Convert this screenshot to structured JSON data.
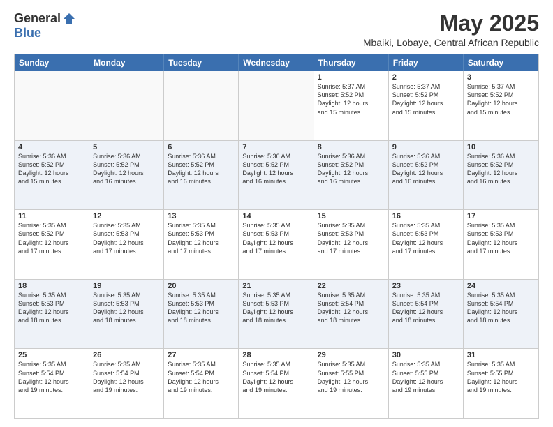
{
  "logo": {
    "general": "General",
    "blue": "Blue"
  },
  "title": "May 2025",
  "location": "Mbaiki, Lobaye, Central African Republic",
  "days_header": [
    "Sunday",
    "Monday",
    "Tuesday",
    "Wednesday",
    "Thursday",
    "Friday",
    "Saturday"
  ],
  "rows": [
    [
      {
        "day": "",
        "info": ""
      },
      {
        "day": "",
        "info": ""
      },
      {
        "day": "",
        "info": ""
      },
      {
        "day": "",
        "info": ""
      },
      {
        "day": "1",
        "info": "Sunrise: 5:37 AM\nSunset: 5:52 PM\nDaylight: 12 hours\nand 15 minutes."
      },
      {
        "day": "2",
        "info": "Sunrise: 5:37 AM\nSunset: 5:52 PM\nDaylight: 12 hours\nand 15 minutes."
      },
      {
        "day": "3",
        "info": "Sunrise: 5:37 AM\nSunset: 5:52 PM\nDaylight: 12 hours\nand 15 minutes."
      }
    ],
    [
      {
        "day": "4",
        "info": "Sunrise: 5:36 AM\nSunset: 5:52 PM\nDaylight: 12 hours\nand 15 minutes."
      },
      {
        "day": "5",
        "info": "Sunrise: 5:36 AM\nSunset: 5:52 PM\nDaylight: 12 hours\nand 16 minutes."
      },
      {
        "day": "6",
        "info": "Sunrise: 5:36 AM\nSunset: 5:52 PM\nDaylight: 12 hours\nand 16 minutes."
      },
      {
        "day": "7",
        "info": "Sunrise: 5:36 AM\nSunset: 5:52 PM\nDaylight: 12 hours\nand 16 minutes."
      },
      {
        "day": "8",
        "info": "Sunrise: 5:36 AM\nSunset: 5:52 PM\nDaylight: 12 hours\nand 16 minutes."
      },
      {
        "day": "9",
        "info": "Sunrise: 5:36 AM\nSunset: 5:52 PM\nDaylight: 12 hours\nand 16 minutes."
      },
      {
        "day": "10",
        "info": "Sunrise: 5:36 AM\nSunset: 5:52 PM\nDaylight: 12 hours\nand 16 minutes."
      }
    ],
    [
      {
        "day": "11",
        "info": "Sunrise: 5:35 AM\nSunset: 5:52 PM\nDaylight: 12 hours\nand 17 minutes."
      },
      {
        "day": "12",
        "info": "Sunrise: 5:35 AM\nSunset: 5:53 PM\nDaylight: 12 hours\nand 17 minutes."
      },
      {
        "day": "13",
        "info": "Sunrise: 5:35 AM\nSunset: 5:53 PM\nDaylight: 12 hours\nand 17 minutes."
      },
      {
        "day": "14",
        "info": "Sunrise: 5:35 AM\nSunset: 5:53 PM\nDaylight: 12 hours\nand 17 minutes."
      },
      {
        "day": "15",
        "info": "Sunrise: 5:35 AM\nSunset: 5:53 PM\nDaylight: 12 hours\nand 17 minutes."
      },
      {
        "day": "16",
        "info": "Sunrise: 5:35 AM\nSunset: 5:53 PM\nDaylight: 12 hours\nand 17 minutes."
      },
      {
        "day": "17",
        "info": "Sunrise: 5:35 AM\nSunset: 5:53 PM\nDaylight: 12 hours\nand 17 minutes."
      }
    ],
    [
      {
        "day": "18",
        "info": "Sunrise: 5:35 AM\nSunset: 5:53 PM\nDaylight: 12 hours\nand 18 minutes."
      },
      {
        "day": "19",
        "info": "Sunrise: 5:35 AM\nSunset: 5:53 PM\nDaylight: 12 hours\nand 18 minutes."
      },
      {
        "day": "20",
        "info": "Sunrise: 5:35 AM\nSunset: 5:53 PM\nDaylight: 12 hours\nand 18 minutes."
      },
      {
        "day": "21",
        "info": "Sunrise: 5:35 AM\nSunset: 5:53 PM\nDaylight: 12 hours\nand 18 minutes."
      },
      {
        "day": "22",
        "info": "Sunrise: 5:35 AM\nSunset: 5:54 PM\nDaylight: 12 hours\nand 18 minutes."
      },
      {
        "day": "23",
        "info": "Sunrise: 5:35 AM\nSunset: 5:54 PM\nDaylight: 12 hours\nand 18 minutes."
      },
      {
        "day": "24",
        "info": "Sunrise: 5:35 AM\nSunset: 5:54 PM\nDaylight: 12 hours\nand 18 minutes."
      }
    ],
    [
      {
        "day": "25",
        "info": "Sunrise: 5:35 AM\nSunset: 5:54 PM\nDaylight: 12 hours\nand 19 minutes."
      },
      {
        "day": "26",
        "info": "Sunrise: 5:35 AM\nSunset: 5:54 PM\nDaylight: 12 hours\nand 19 minutes."
      },
      {
        "day": "27",
        "info": "Sunrise: 5:35 AM\nSunset: 5:54 PM\nDaylight: 12 hours\nand 19 minutes."
      },
      {
        "day": "28",
        "info": "Sunrise: 5:35 AM\nSunset: 5:54 PM\nDaylight: 12 hours\nand 19 minutes."
      },
      {
        "day": "29",
        "info": "Sunrise: 5:35 AM\nSunset: 5:55 PM\nDaylight: 12 hours\nand 19 minutes."
      },
      {
        "day": "30",
        "info": "Sunrise: 5:35 AM\nSunset: 5:55 PM\nDaylight: 12 hours\nand 19 minutes."
      },
      {
        "day": "31",
        "info": "Sunrise: 5:35 AM\nSunset: 5:55 PM\nDaylight: 12 hours\nand 19 minutes."
      }
    ]
  ],
  "colors": {
    "header_bg": "#3a6faf",
    "header_text": "#ffffff",
    "alt_row_bg": "#eef2f8",
    "border": "#cccccc"
  }
}
